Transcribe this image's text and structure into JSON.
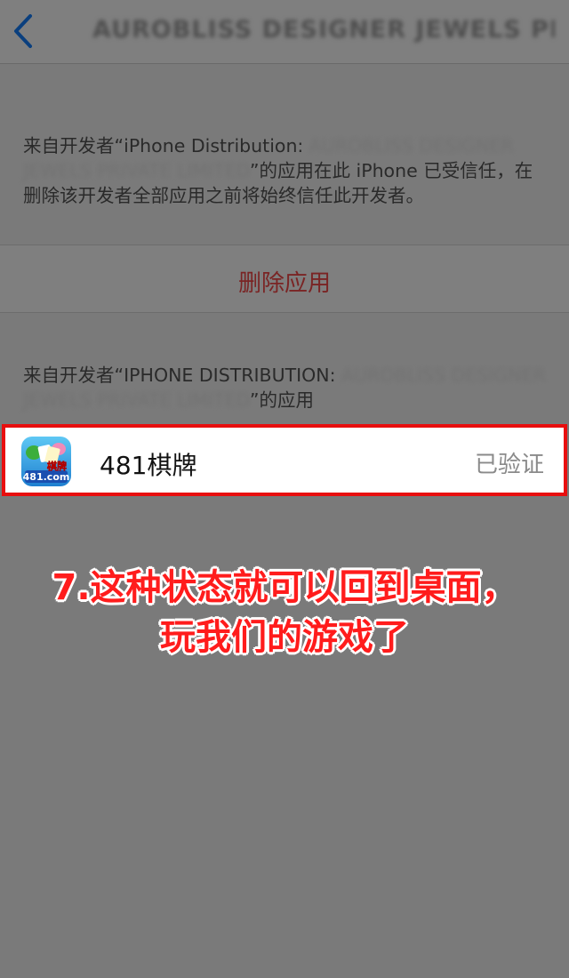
{
  "nav": {
    "back_icon": "chevron-left-icon",
    "title": "AUROBLISS DESIGNER JEWELS PRI..."
  },
  "trust_section": {
    "prefix": "来自开发者“iPhone Distribution: ",
    "developer": "AUROBLISS DESIGNER JEWELS PRIVATE LIMITED",
    "suffix": "”的应用在此 iPhone 已受信任，在删除该开发者全部应用之前将始终信任此开发者。"
  },
  "delete_button": {
    "label": "删除应用"
  },
  "apps_section": {
    "prefix": "来自开发者“IPHONE DISTRIBUTION: ",
    "developer": "AUROBLISS DESIGNER JEWELS PRIVATE LIMITED",
    "suffix": "”的应用"
  },
  "app_row": {
    "icon_text": "481.com",
    "icon_badge": "棋牌",
    "name": "481棋牌",
    "status": "已验证"
  },
  "caption": {
    "line1": "7.这种状态就可以回到桌面，",
    "line2": "玩我们的游戏了"
  },
  "colors": {
    "highlight_border": "#e80e0e",
    "caption_text": "#ff1c1c",
    "delete_text": "#7a2424",
    "back_icon": "#0a3f7e"
  }
}
